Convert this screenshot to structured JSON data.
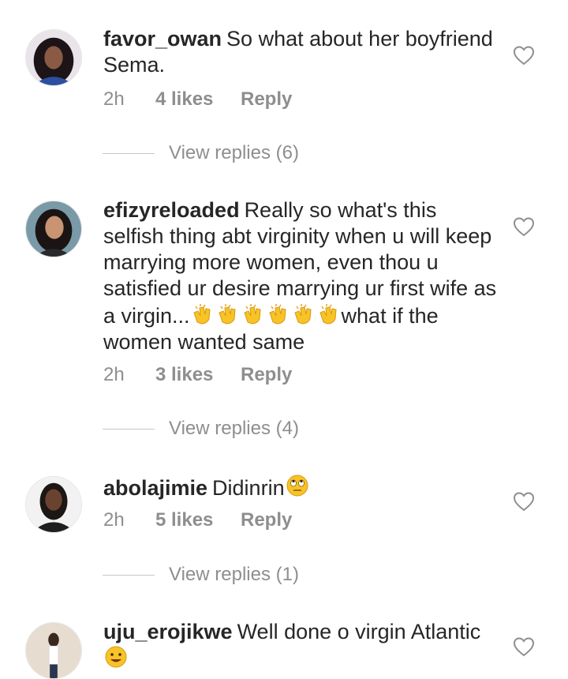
{
  "comments": [
    {
      "username": "favor_owan",
      "text": "So what about her boyfriend  Sema.",
      "time": "2h",
      "likes": "4 likes",
      "reply": "Reply",
      "view_replies": "View replies (6)"
    },
    {
      "username": "efizyreloaded",
      "text": "Really so what's this selfish thing abt virginity when u will keep marrying more women, even thou u satisfied ur desire marrying ur first wife as a virgin...",
      "text_after_emoji": "what if the women wanted same",
      "emoji": "clapping-hands x6",
      "time": "2h",
      "likes": "3 likes",
      "reply": "Reply",
      "view_replies": "View replies (4)"
    },
    {
      "username": "abolajimie",
      "text": "Didinrin",
      "emoji": "eye-roll-face",
      "time": "2h",
      "likes": "5 likes",
      "reply": "Reply",
      "view_replies": "View replies (1)"
    },
    {
      "username": "uju_erojikwe",
      "text": "Well done o virgin Atlantic",
      "emoji": "grinning-face"
    }
  ],
  "icons": {
    "like": "heart-outline-icon"
  },
  "colors": {
    "text": "#262626",
    "meta": "#8e8e8e",
    "divider": "#c7c7c7"
  }
}
